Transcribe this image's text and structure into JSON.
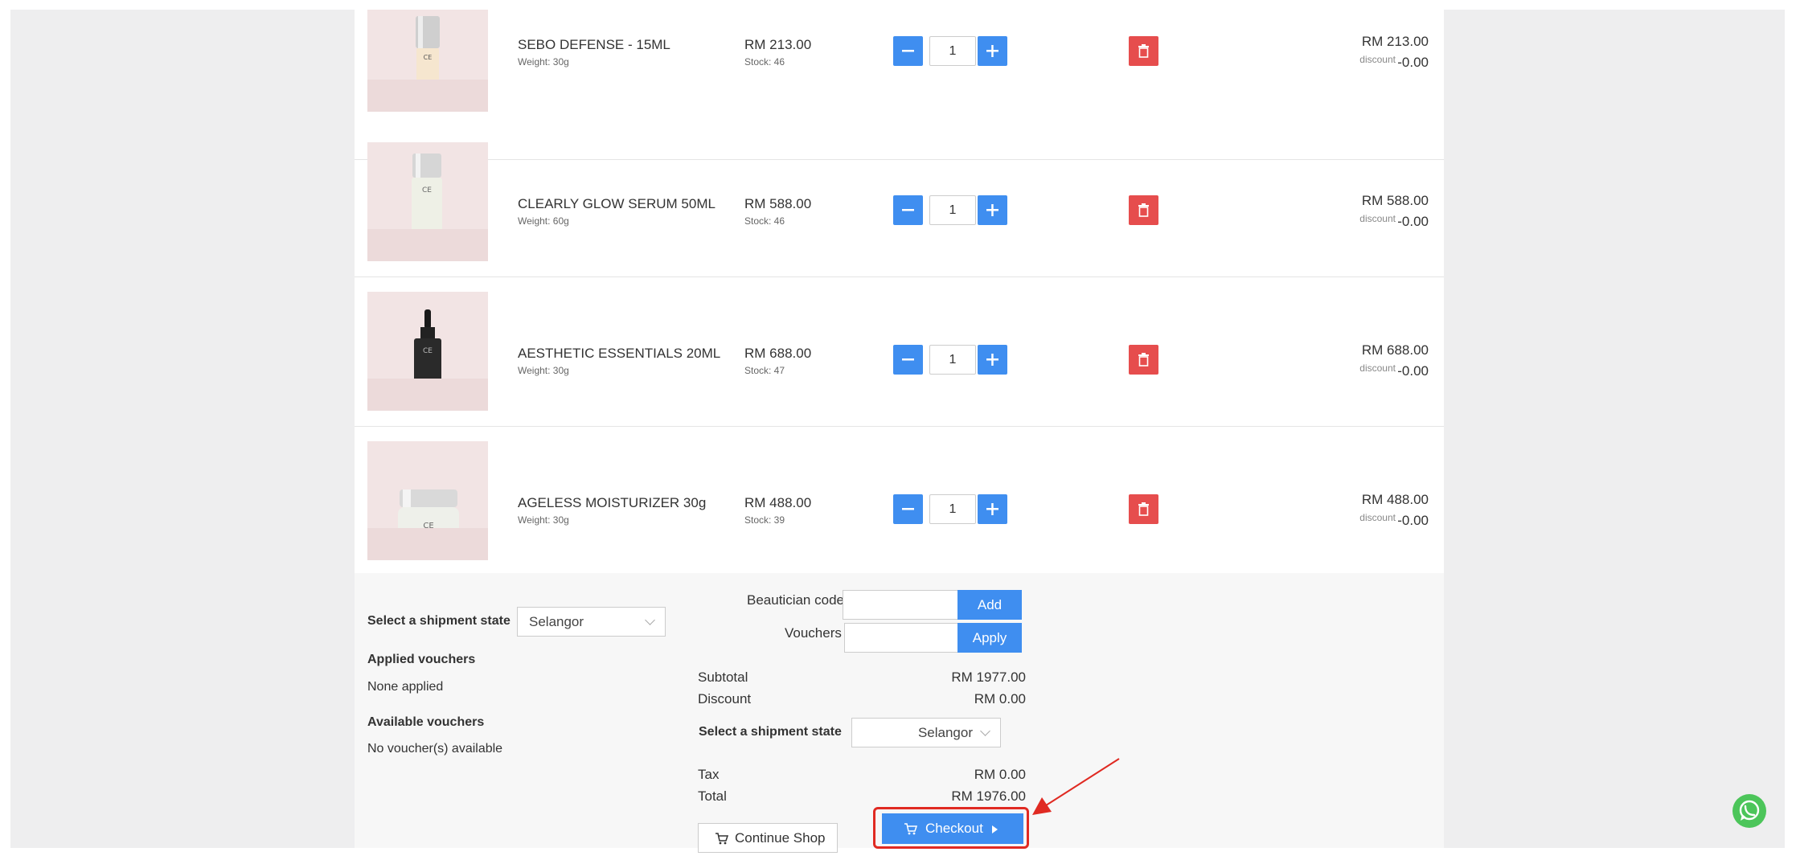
{
  "cart": {
    "items": [
      {
        "name": "SEBO DEFENSE - 15ML",
        "weight": "Weight: 30g",
        "price": "RM 213.00",
        "stock": "Stock: 46",
        "qty": "1",
        "line_total": "RM 213.00",
        "discount_label": "discount",
        "discount": "-0.00"
      },
      {
        "name": "CLEARLY GLOW SERUM 50ML",
        "weight": "Weight: 60g",
        "price": "RM 588.00",
        "stock": "Stock: 46",
        "qty": "1",
        "line_total": "RM 588.00",
        "discount_label": "discount",
        "discount": "-0.00"
      },
      {
        "name": "AESTHETIC ESSENTIALS 20ML",
        "weight": "Weight: 30g",
        "price": "RM 688.00",
        "stock": "Stock: 47",
        "qty": "1",
        "line_total": "RM 688.00",
        "discount_label": "discount",
        "discount": "-0.00"
      },
      {
        "name": "AGELESS MOISTURIZER 30g",
        "weight": "Weight: 30g",
        "price": "RM 488.00",
        "stock": "Stock: 39",
        "qty": "1",
        "line_total": "RM 488.00",
        "discount_label": "discount",
        "discount": "-0.00"
      }
    ]
  },
  "left": {
    "shipment_label": "Select a shipment state",
    "shipment_value": "Selangor",
    "applied_title": "Applied vouchers",
    "applied_value": "None applied",
    "available_title": "Available vouchers",
    "available_value": "No voucher(s) available"
  },
  "codes": {
    "beautician_label": "Beautician code",
    "add_label": "Add",
    "vouchers_label": "Vouchers",
    "apply_label": "Apply"
  },
  "summary": {
    "subtotal_label": "Subtotal",
    "subtotal": "RM 1977.00",
    "discount_label": "Discount",
    "discount": "RM 0.00",
    "shipment_label": "Select a shipment state",
    "shipment_value": "Selangor",
    "tax_label": "Tax",
    "tax": "RM 0.00",
    "total_label": "Total",
    "total": "RM 1976.00"
  },
  "actions": {
    "continue_label": "Continue Shop",
    "checkout_label": "Checkout"
  },
  "colors": {
    "accent": "#3f8ef0",
    "danger": "#e64d4d",
    "annotation": "#e02a22",
    "whatsapp": "#4cc55a"
  },
  "icons": [
    "minus-icon",
    "plus-icon",
    "trash-icon",
    "cart-icon",
    "caret-right-icon",
    "chevron-down-icon",
    "whatsapp-icon"
  ]
}
